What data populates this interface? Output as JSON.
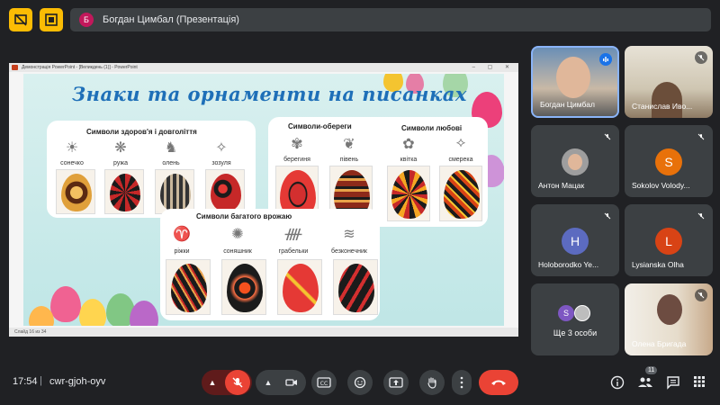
{
  "top": {
    "presenter_avatar_letter": "Б",
    "presenter_label": "Богдан Цимбал (Презентація)"
  },
  "ppt": {
    "window_title": "Демонстрація PowerPoint - [Великдень (1)] - PowerPoint",
    "status": "Слайд 16 из 34"
  },
  "slide": {
    "title": "Знаки та орнаменти на писанках",
    "panels": [
      {
        "title": "Символи здоров'я і довголіття",
        "items": [
          "сонечко",
          "ружа",
          "олень",
          "зозуля"
        ]
      },
      {
        "title": "Символи-обереги",
        "items": [
          "берегиня",
          "півень"
        ]
      },
      {
        "title": "Символи любові",
        "items": [
          "квітка",
          "смерека"
        ]
      },
      {
        "title": "Символи багатого врожаю",
        "items": [
          "ріжки",
          "соняшник",
          "грабельки",
          "безконечник"
        ]
      }
    ]
  },
  "participants": [
    {
      "name": "Богдан Цимбал",
      "type": "video",
      "speaking": true
    },
    {
      "name": "Станислав Иво...",
      "type": "video",
      "muted": true
    },
    {
      "name": "Антон Мацак",
      "type": "photo",
      "muted": true
    },
    {
      "name": "Sokolov Volody...",
      "type": "letter",
      "letter": "S",
      "color": "#e8710a",
      "muted": true
    },
    {
      "name": "Holoborodko Ye...",
      "type": "letter",
      "letter": "H",
      "color": "#5c6bc0",
      "muted": true
    },
    {
      "name": "Lysianska Olha",
      "type": "letter",
      "letter": "L",
      "color": "#d84315",
      "muted": true
    },
    {
      "name": "Ще 3 особи",
      "type": "more",
      "letter": "S",
      "color": "#7e57c2"
    },
    {
      "name": "Олена Бригада",
      "type": "video",
      "muted": true
    }
  ],
  "bottom": {
    "time": "17:54",
    "separator": "|",
    "meeting_code": "cwr-gjoh-oyv",
    "participant_count": "11"
  },
  "colors": {
    "accent_yellow": "#fbbc04",
    "end_call": "#ea4335",
    "mic_off": "#ea4335",
    "speaking_blue": "#1a73e8"
  }
}
